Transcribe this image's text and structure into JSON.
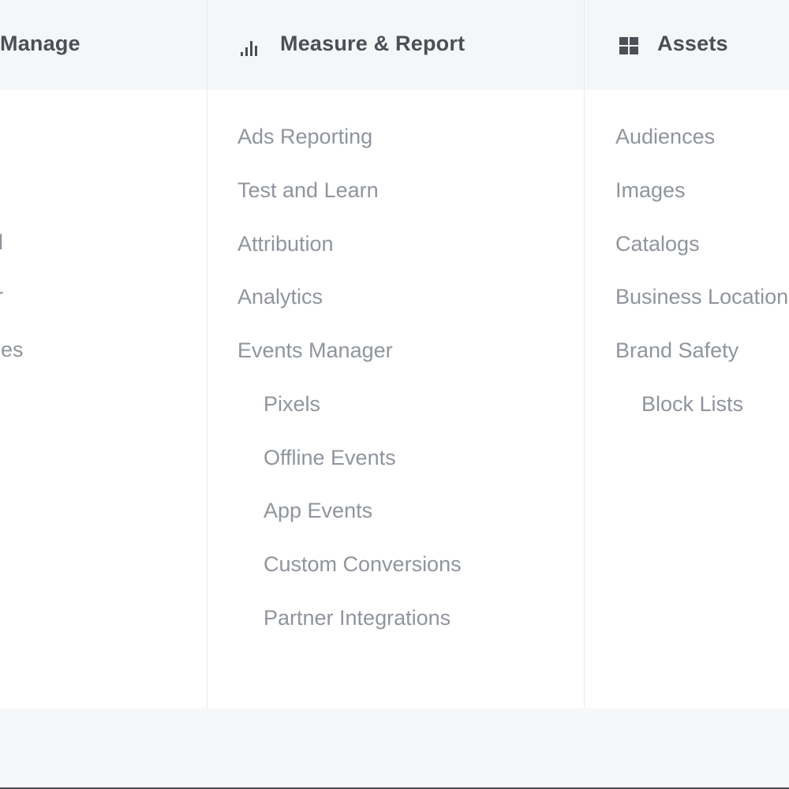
{
  "columns": {
    "manage": {
      "title": "Manage",
      "items": [
        {
          "label": "rd"
        },
        {
          "label": "er"
        },
        {
          "label": "ules"
        }
      ]
    },
    "measure": {
      "title": "Measure & Report",
      "icon": "bar-chart-icon",
      "items": [
        {
          "label": "Ads Reporting"
        },
        {
          "label": "Test and Learn"
        },
        {
          "label": "Attribution"
        },
        {
          "label": "Analytics"
        },
        {
          "label": "Events Manager"
        },
        {
          "label": "Pixels"
        },
        {
          "label": "Offline Events"
        },
        {
          "label": "App Events"
        },
        {
          "label": "Custom Conversions"
        },
        {
          "label": "Partner Integrations"
        }
      ]
    },
    "assets": {
      "title": "Assets",
      "icon": "grid-icon",
      "items": [
        {
          "label": "Audiences"
        },
        {
          "label": "Images"
        },
        {
          "label": "Catalogs"
        },
        {
          "label": "Business Locations"
        },
        {
          "label": "Brand Safety"
        },
        {
          "label": "Block Lists"
        }
      ]
    }
  },
  "colors": {
    "header_bg": "#f5f6f7",
    "header_text": "#4b4f56",
    "item_text": "#90949c",
    "divider": "#e9ebee"
  }
}
